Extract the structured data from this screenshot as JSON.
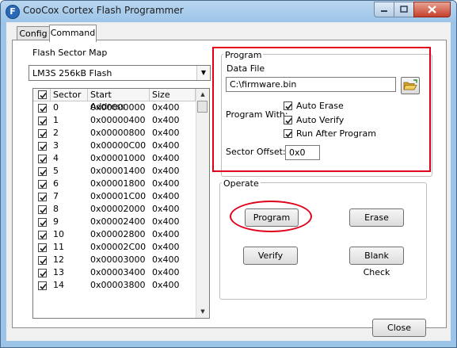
{
  "window": {
    "title": "CooCox Cortex Flash Programmer",
    "app_icon_letter": "F"
  },
  "tabs": [
    {
      "label": "Config"
    },
    {
      "label": "Command"
    }
  ],
  "flash_sector_map": {
    "label": "Flash Sector Map",
    "selected": "LM3S 256kB Flash",
    "columns": [
      "Sector",
      "Start Address",
      "Size"
    ],
    "rows": [
      {
        "sector": "0",
        "address": "0x00000000",
        "size": "0x400"
      },
      {
        "sector": "1",
        "address": "0x00000400",
        "size": "0x400"
      },
      {
        "sector": "2",
        "address": "0x00000800",
        "size": "0x400"
      },
      {
        "sector": "3",
        "address": "0x00000C00",
        "size": "0x400"
      },
      {
        "sector": "4",
        "address": "0x00001000",
        "size": "0x400"
      },
      {
        "sector": "5",
        "address": "0x00001400",
        "size": "0x400"
      },
      {
        "sector": "6",
        "address": "0x00001800",
        "size": "0x400"
      },
      {
        "sector": "7",
        "address": "0x00001C00",
        "size": "0x400"
      },
      {
        "sector": "8",
        "address": "0x00002000",
        "size": "0x400"
      },
      {
        "sector": "9",
        "address": "0x00002400",
        "size": "0x400"
      },
      {
        "sector": "10",
        "address": "0x00002800",
        "size": "0x400"
      },
      {
        "sector": "11",
        "address": "0x00002C00",
        "size": "0x400"
      },
      {
        "sector": "12",
        "address": "0x00003000",
        "size": "0x400"
      },
      {
        "sector": "13",
        "address": "0x00003400",
        "size": "0x400"
      },
      {
        "sector": "14",
        "address": "0x00003800",
        "size": "0x400"
      }
    ]
  },
  "program": {
    "group_label": "Program",
    "data_file_label": "Data File",
    "data_file_value": "C:\\firmware.bin",
    "program_with_label": "Program With:",
    "options": [
      {
        "label": "Auto Erase",
        "checked": true
      },
      {
        "label": "Auto Verify",
        "checked": true
      },
      {
        "label": "Run After Program",
        "checked": true
      }
    ],
    "sector_offset_label": "Sector Offset:",
    "sector_offset_value": "0x0"
  },
  "operate": {
    "group_label": "Operate",
    "program_button": "Program",
    "erase_button": "Erase",
    "verify_button": "Verify",
    "blank_check_button": "Blank Check"
  },
  "close_button": "Close",
  "colors": {
    "highlight_red": "#e0001a",
    "title_bar": "#9cc4e8"
  }
}
